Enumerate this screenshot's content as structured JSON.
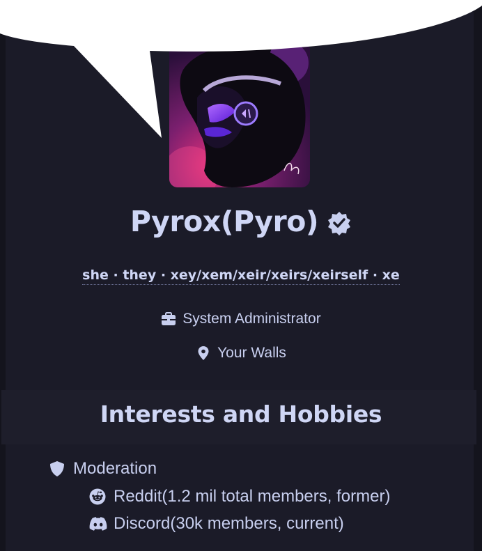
{
  "profile": {
    "name": "Pyrox(Pyro)",
    "pronouns": "she · they · xey/xem/xeir/xeirs/xeirself · xe",
    "job": "System Administrator",
    "location": "Your Walls",
    "avatar_icon": "purple-horned-character-avatar",
    "verified_icon": "verified-badge-icon"
  },
  "interests": {
    "title": "Interests and Hobbies",
    "items": [
      {
        "label": "Moderation",
        "icon": "shield-icon"
      },
      {
        "label": "Reddit(1.2 mil total members, former)",
        "icon": "reddit-icon"
      },
      {
        "label": "Discord(30k members, current)",
        "icon": "discord-icon"
      }
    ]
  },
  "colors": {
    "background": "#1b1b28",
    "text": "#cfd6f5",
    "bubble": "#ffffff",
    "avatar_accent": "#7b3cff"
  }
}
